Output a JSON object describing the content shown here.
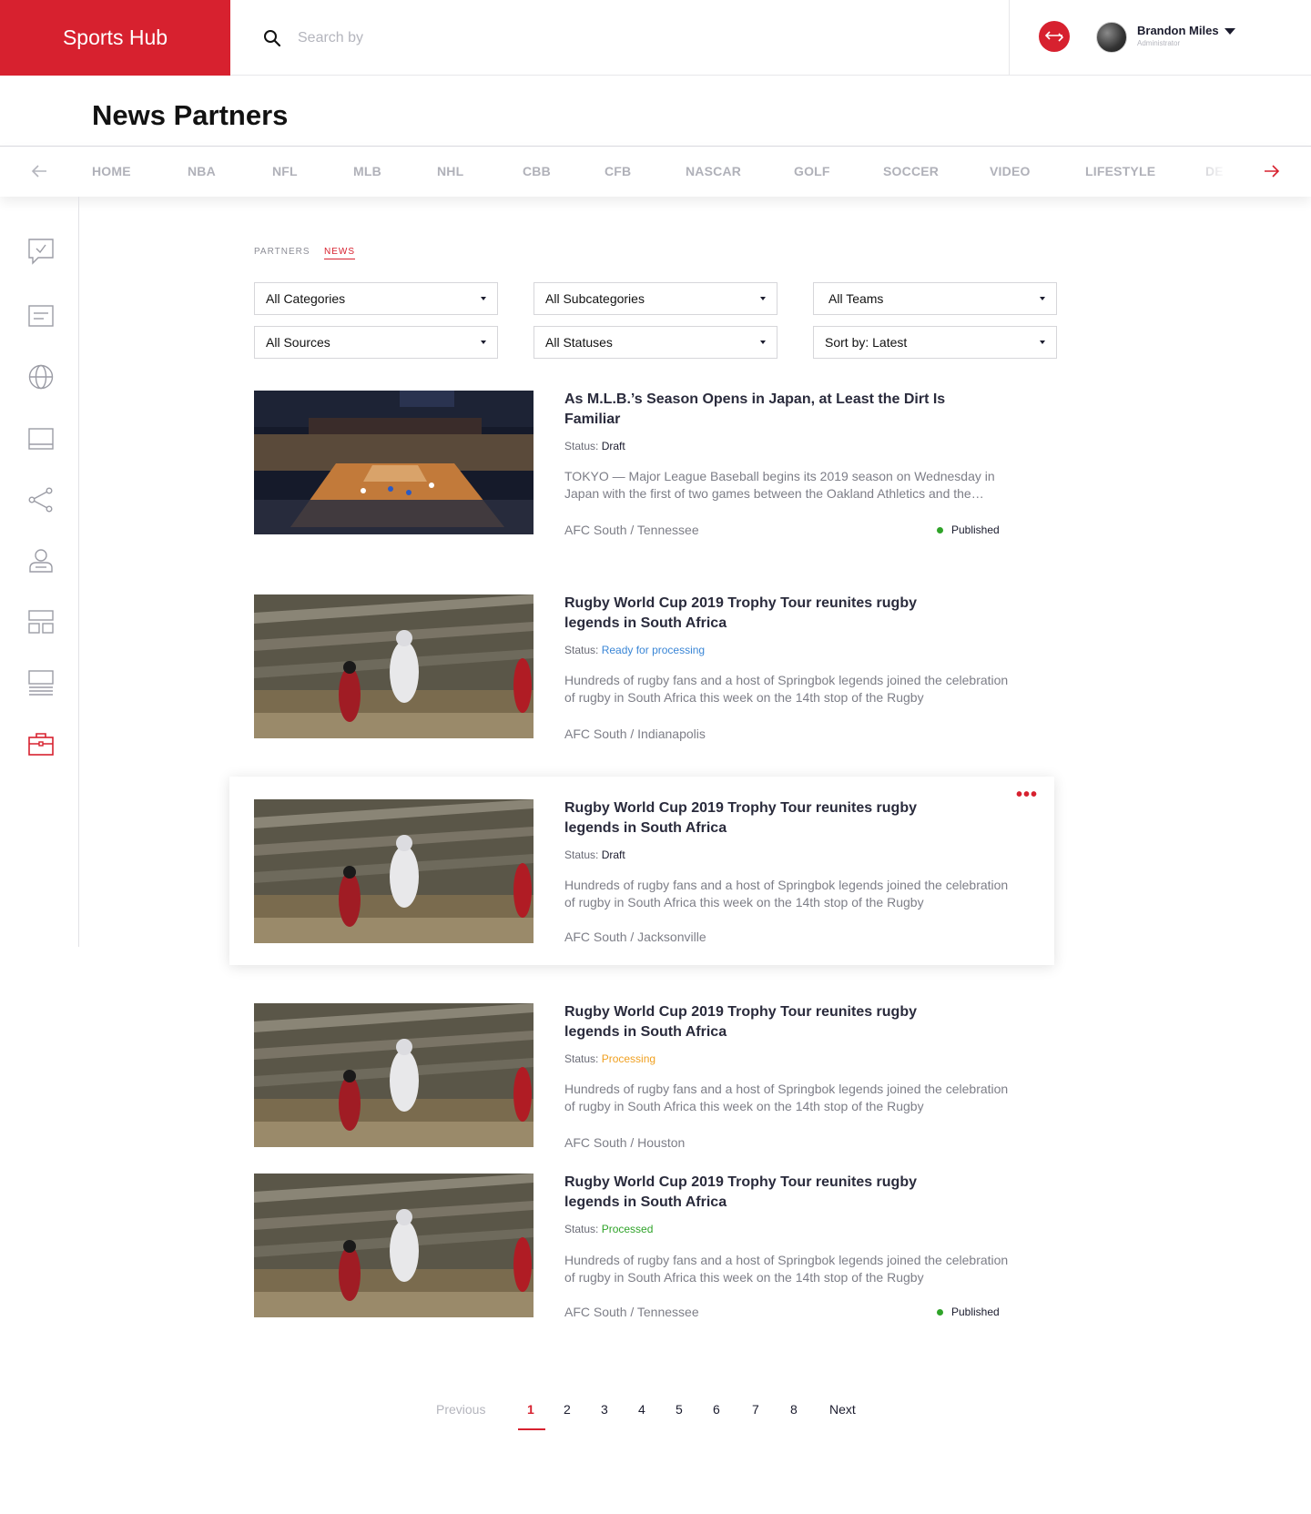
{
  "app": {
    "brand": "Sports Hub"
  },
  "search": {
    "placeholder": "Search by"
  },
  "user": {
    "name": "Brandon Miles",
    "role": "Administrator"
  },
  "page": {
    "title": "News Partners"
  },
  "nav": {
    "items": [
      "HOME",
      "NBA",
      "NFL",
      "MLB",
      "NHL",
      "CBB",
      "CFB",
      "NASCAR",
      "GOLF",
      "SOCCER",
      "VIDEO",
      "LIFESTYLE",
      "DE"
    ]
  },
  "sidebar": {
    "icons": [
      "survey-icon",
      "article-icon",
      "globe-icon",
      "screen-icon",
      "share-icon",
      "users-icon",
      "layout-icon",
      "list-icon",
      "briefcase-icon"
    ],
    "active": "briefcase-icon",
    "accent": "#d7212f"
  },
  "tabs": {
    "partners": "PARTNERS",
    "news": "NEWS"
  },
  "filters": {
    "categories": "All Categories",
    "subcategories": "All Subcategories",
    "teams": "All Teams",
    "sources": "All Sources",
    "statuses": "All Statuses",
    "sort": "Sort by: Latest"
  },
  "articles": [
    {
      "title": "As M.L.B.’s Season Opens in Japan, at Least the Dirt Is Familiar",
      "status_label": "Status:",
      "status": "Draft",
      "status_color": "#1b1c2e",
      "description": "TOKYO — Major League Baseball begins its 2019 season on Wednesday in Japan with the first of two games between the Oakland Athletics and the…",
      "team": "AFC South / Tennessee",
      "published": "Published"
    },
    {
      "title": "Rugby World Cup 2019 Trophy Tour reunites rugby legends in South Africa",
      "status_label": "Status:",
      "status": "Ready for processing",
      "status_color": "#3a86d6",
      "description": "Hundreds of rugby fans and a host of Springbok legends joined the celebration of rugby in South Africa this week on the 14th stop of the Rugby",
      "team": "AFC South / Indianapolis"
    },
    {
      "title": "Rugby World Cup 2019 Trophy Tour reunites rugby legends in South Africa",
      "status_label": "Status:",
      "status": "Draft",
      "status_color": "#1b1c2e",
      "description": "Hundreds of rugby fans and a host of Springbok legends joined the celebration of rugby in South Africa this week on the 14th stop of the Rugby",
      "team": "AFC South / Jacksonville",
      "more": "•••"
    },
    {
      "title": "Rugby World Cup 2019 Trophy Tour reunites rugby legends in South Africa",
      "status_label": "Status:",
      "status": "Processing",
      "status_color": "#f0a020",
      "description": "Hundreds of rugby fans and a host of Springbok legends joined the celebration of rugby in South Africa this week on the 14th stop of the Rugby",
      "team": "AFC South / Houston"
    },
    {
      "title": "Rugby World Cup 2019 Trophy Tour reunites rugby legends in South Africa",
      "status_label": "Status:",
      "status": "Processed",
      "status_color": "#2fa329",
      "description": "Hundreds of rugby fans and a host of Springbok legends joined the celebration of rugby in South Africa this week on the 14th stop of the Rugby",
      "team": "AFC South / Tennessee",
      "published": "Published"
    }
  ],
  "pagination": {
    "previous": "Previous",
    "pages": [
      "1",
      "2",
      "3",
      "4",
      "5",
      "6",
      "7",
      "8"
    ],
    "current": "1",
    "next": "Next"
  }
}
